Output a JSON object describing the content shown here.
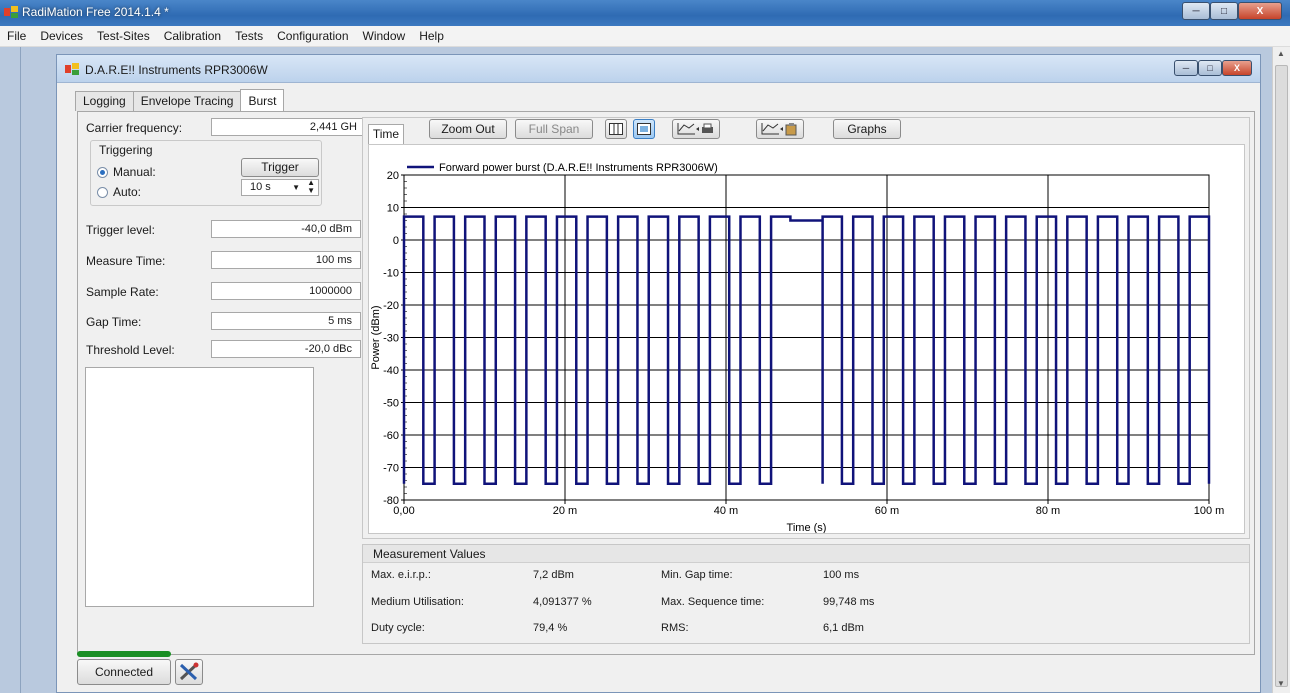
{
  "window": {
    "title": "RadiMation Free 2014.1.4 *",
    "min_glyph": "─",
    "max_glyph": "□",
    "close_glyph": "X"
  },
  "menu": [
    "File",
    "Devices",
    "Test-Sites",
    "Calibration",
    "Tests",
    "Configuration",
    "Window",
    "Help"
  ],
  "child": {
    "title": "D.A.R.E!! Instruments RPR3006W"
  },
  "tabs": [
    {
      "label": "Logging",
      "active": false
    },
    {
      "label": "Envelope Tracing",
      "active": false
    },
    {
      "label": "Burst",
      "active": true
    }
  ],
  "form": {
    "carrier_frequency": {
      "label": "Carrier frequency:",
      "value": "2,441 GH"
    },
    "triggering": {
      "title": "Triggering",
      "manual": "Manual:",
      "auto": "Auto:",
      "trigger_button": "Trigger",
      "interval": "10 s",
      "mode": "manual"
    },
    "trigger_level": {
      "label": "Trigger level:",
      "value": "-40,0 dBm"
    },
    "measure_time": {
      "label": "Measure Time:",
      "value": "100 ms"
    },
    "sample_rate": {
      "label": "Sample Rate:",
      "value": "1000000"
    },
    "gap_time": {
      "label": "Gap Time:",
      "value": "5 ms"
    },
    "threshold_level": {
      "label": "Threshold Level:",
      "value": "-20,0 dBc"
    }
  },
  "graph_toolbar": {
    "time_tab": "Time",
    "zoom_out": "Zoom Out",
    "full_span": "Full Span",
    "graphs": "Graphs"
  },
  "measurements": {
    "title": "Measurement Values",
    "rows": [
      {
        "label": "Max. e.i.r.p.:",
        "value": "7,2 dBm",
        "label2": "Min. Gap time:",
        "value2": "100 ms"
      },
      {
        "label": "Medium Utilisation:",
        "value": "4,091377 %",
        "label2": "Max. Sequence time:",
        "value2": "99,748 ms"
      },
      {
        "label": "Duty cycle:",
        "value": "79,4 %",
        "label2": "RMS:",
        "value2": "6,1 dBm"
      }
    ]
  },
  "status": {
    "connected": "Connected",
    "color": "#1a8f24"
  },
  "chart_data": {
    "type": "line",
    "title": "",
    "xlabel": "Time (s)",
    "ylabel": "Power (dBm)",
    "xlim": [
      0,
      0.1
    ],
    "ylim": [
      -80,
      20
    ],
    "x_ticks": [
      0,
      0.02,
      0.04,
      0.06,
      0.08,
      0.1
    ],
    "x_tick_labels": [
      "0,00",
      "20 m",
      "40 m",
      "60 m",
      "80 m",
      "100 m"
    ],
    "y_ticks": [
      20,
      10,
      0,
      -10,
      -20,
      -30,
      -40,
      -50,
      -60,
      -70,
      -80
    ],
    "y_tick_labels": [
      "20",
      "10",
      "0",
      "-10",
      "-20",
      "-30",
      "-40",
      "-50",
      "-60",
      "-70",
      "-80"
    ],
    "grid": true,
    "legend_position": "top-left",
    "series": [
      {
        "name": "Forward power burst (D.A.R.E!! Instruments RPR3006W)",
        "color": "#10137a",
        "high_level": 7.2,
        "low_level": -75,
        "pulses_ms": [
          [
            0.0,
            2.4
          ],
          [
            3.8,
            6.2
          ],
          [
            7.6,
            10.0
          ],
          [
            11.4,
            13.8
          ],
          [
            15.2,
            17.6
          ],
          [
            19.0,
            21.4
          ],
          [
            22.8,
            25.2
          ],
          [
            26.6,
            29.0
          ],
          [
            30.4,
            32.8
          ],
          [
            34.2,
            36.6
          ],
          [
            38.0,
            40.4
          ],
          [
            41.8,
            44.2
          ],
          [
            45.6,
            48.0
          ],
          [
            52.0,
            54.4
          ],
          [
            55.8,
            58.2
          ],
          [
            59.6,
            62.0
          ],
          [
            63.4,
            65.8
          ],
          [
            67.2,
            69.6
          ],
          [
            71.0,
            73.4
          ],
          [
            74.8,
            77.2
          ],
          [
            78.6,
            81.0
          ],
          [
            82.4,
            84.8
          ],
          [
            86.2,
            88.6
          ],
          [
            90.0,
            92.4
          ],
          [
            93.8,
            96.2
          ],
          [
            97.6,
            100.0
          ]
        ],
        "reduced_segment_ms": [
          48.0,
          52.0
        ],
        "reduced_level": 6.0
      }
    ]
  }
}
